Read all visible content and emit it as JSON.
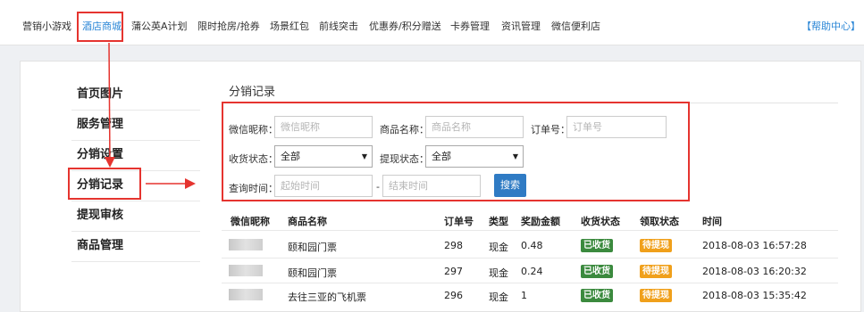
{
  "topnav": {
    "items": [
      "营销小游戏",
      "酒店商城",
      "蒲公英A计划",
      "限时抢房/抢券",
      "场景红包",
      "前线突击",
      "优惠券/积分赠送",
      "卡券管理",
      "资讯管理",
      "微信便利店"
    ],
    "active_index": 1,
    "help": "【帮助中心】"
  },
  "sidebar": {
    "items": [
      "首页图片",
      "服务管理",
      "分销设置",
      "分销记录",
      "提现审核",
      "商品管理"
    ],
    "active_index": 3
  },
  "section_title": "分销记录",
  "filters": {
    "nickname_label": "微信昵称：",
    "nickname_placeholder": "微信昵称",
    "product_label": "商品名称：",
    "product_placeholder": "商品名称",
    "order_label": "订单号：",
    "order_placeholder": "订单号",
    "receipt_label": "收货状态：",
    "receipt_value": "全部",
    "withdraw_label": "提现状态：",
    "withdraw_value": "全部",
    "time_label": "查询时间：",
    "start_placeholder": "起始时间",
    "dash": "-",
    "end_placeholder": "结束时间",
    "search_button": "搜索"
  },
  "table": {
    "headers": [
      "微信昵称",
      "商品名称",
      "订单号",
      "类型",
      "奖励金额",
      "收货状态",
      "领取状态",
      "时间"
    ],
    "rows": [
      {
        "product": "颐和园门票",
        "order": "298",
        "type": "现金",
        "amount": "0.48",
        "receipt": "已收货",
        "claim": "待提现",
        "time": "2018-08-03 16:57:28"
      },
      {
        "product": "颐和园门票",
        "order": "297",
        "type": "现金",
        "amount": "0.24",
        "receipt": "已收货",
        "claim": "待提现",
        "time": "2018-08-03 16:20:32"
      },
      {
        "product": "去往三亚的飞机票",
        "order": "296",
        "type": "现金",
        "amount": "1",
        "receipt": "已收货",
        "claim": "待提现",
        "time": "2018-08-03 15:35:42"
      }
    ]
  },
  "colors": {
    "accent": "#2a86d6",
    "highlight_red": "#e5342f",
    "badge_green": "#3b8a3e",
    "badge_orange": "#f0a01b",
    "button_blue": "#2f7bc4"
  }
}
